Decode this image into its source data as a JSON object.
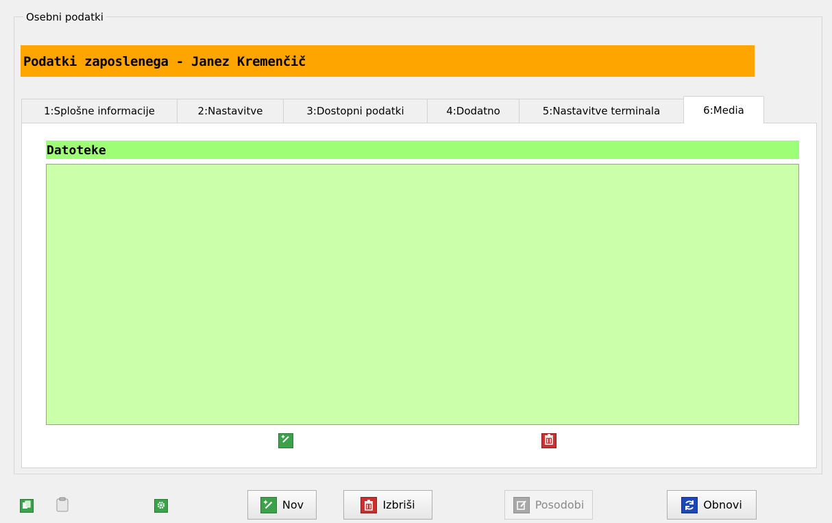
{
  "group": {
    "legend": "Osebni podatki"
  },
  "header": {
    "title": "Podatki zaposlenega - Janez Kremenčič",
    "color": "#ffa500"
  },
  "tabs": [
    {
      "label": "1:Splošne informacije",
      "active": false
    },
    {
      "label": "2:Nastavitve",
      "active": false
    },
    {
      "label": "3:Dostopni podatki",
      "active": false
    },
    {
      "label": "4:Dodatno",
      "active": false
    },
    {
      "label": "5:Nastavitve terminala",
      "active": false
    },
    {
      "label": "6:Media",
      "active": true
    }
  ],
  "media": {
    "section_title": "Datoteke",
    "section_color": "#9eff77",
    "list_color": "#ccffaa",
    "add_icon": "magic-wand-icon",
    "delete_icon": "trash-icon"
  },
  "toolbar": {
    "copy_icon": "copy-icon",
    "paste_icon": "clipboard-icon",
    "settings_icon": "gear-icon",
    "new_label": "Nov",
    "delete_label": "Izbriši",
    "update_label": "Posodobi",
    "refresh_label": "Obnovi"
  }
}
